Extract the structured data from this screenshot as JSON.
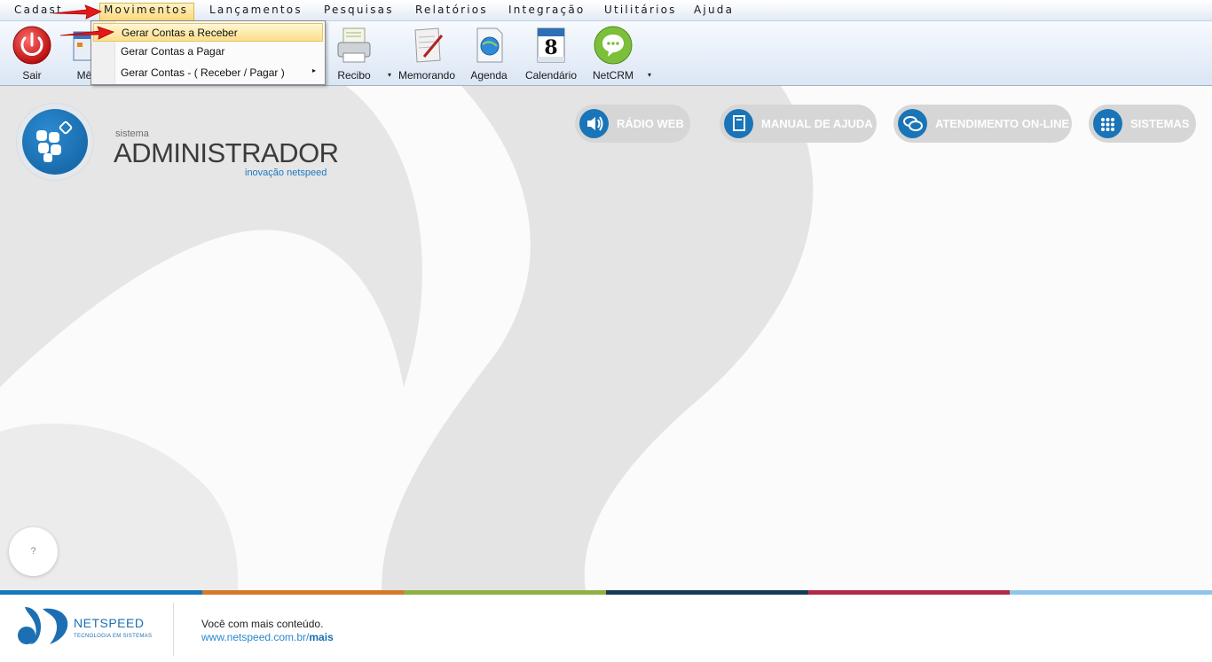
{
  "menu": {
    "items": [
      {
        "label": "Cadastros",
        "shown": "Cadast"
      },
      {
        "label": "Movimentos"
      },
      {
        "label": "Lançamentos"
      },
      {
        "label": "Pesquisas"
      },
      {
        "label": "Relatórios"
      },
      {
        "label": "Integração"
      },
      {
        "label": "Utilitários"
      },
      {
        "label": "Ajuda"
      }
    ]
  },
  "dropdown": {
    "items": [
      {
        "label": "Gerar Contas a Receber",
        "highlighted": true
      },
      {
        "label": "Gerar Contas a Pagar"
      },
      {
        "label": "Gerar Contas - ( Receber / Pagar )",
        "submenu_arrow": "▸"
      }
    ]
  },
  "toolbar": {
    "sair": "Sair",
    "mes": "Mês",
    "recibo": "Recibo",
    "memorando": "Memorando",
    "agenda": "Agenda",
    "calendario": "Calendário",
    "calendario_day": "8",
    "netcrm": "NetCRM",
    "dropdown_arrow": "▾"
  },
  "brand": {
    "small": "sistema",
    "title": "ADMINISTRADOR",
    "tagline": "inovação netspeed"
  },
  "pills": {
    "radio": "RÁDIO WEB",
    "manual": "MANUAL DE AJUDA",
    "atendimento": "ATENDIMENTO ON-LINE",
    "sistemas": "SISTEMAS"
  },
  "help_button": "?",
  "color_band": [
    "#1577be",
    "#d6782a",
    "#8fb043",
    "#163b5a",
    "#b12b47",
    "#8ec5ec"
  ],
  "footer": {
    "company": "NETSPEED",
    "company_tag": "TECNOLOGIA EM SISTEMAS",
    "line1": "Você com mais conteúdo.",
    "link_base": "www.netspeed.com.br/",
    "link_bold": "mais"
  },
  "colors": {
    "accent": "#1a74b8",
    "highlight": "#fcd87a",
    "arrow": "#e21a1a"
  }
}
